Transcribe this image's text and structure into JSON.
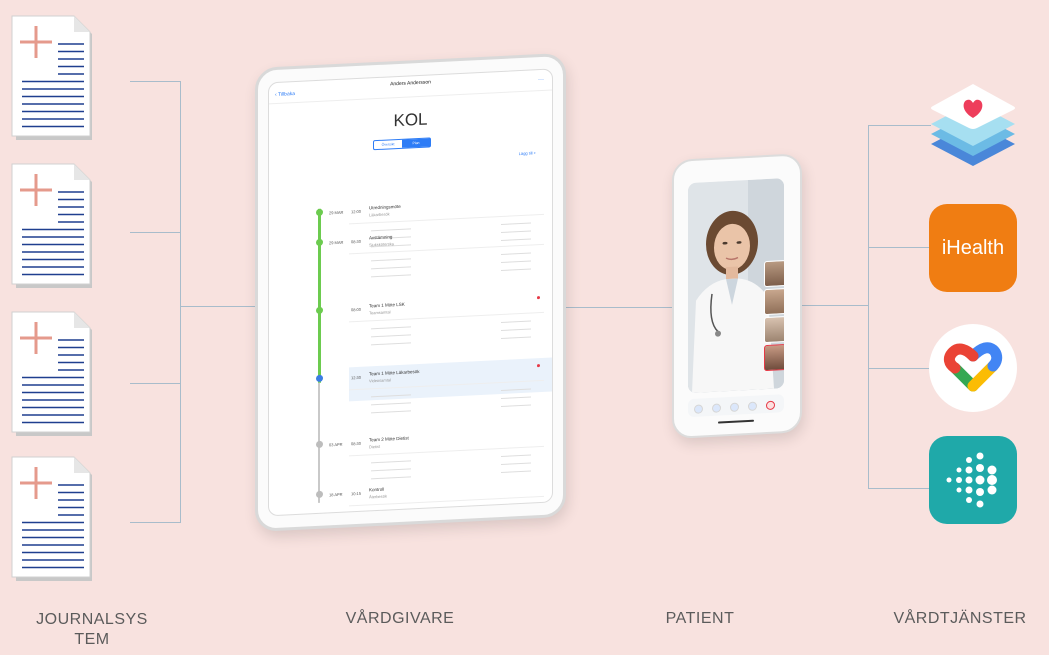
{
  "labels": {
    "journal_line1": "JOURNALSYS",
    "journal_line2": "TEM",
    "caregiver": "VÅRDGIVARE",
    "patient": "PATIENT",
    "services": "VÅRDTJÄNSTER"
  },
  "tablet": {
    "back": "Tillbaka",
    "patient_name": "Anders Andersson",
    "title": "KOL",
    "segment_left": "Översikt",
    "segment_right": "Plan",
    "add": "Lägg till",
    "rows": [
      {
        "date": "29 MAR",
        "time": "12:00",
        "title": "Utredningsmöte",
        "sub": "Läkarbesök"
      },
      {
        "date": "29 MAR",
        "time": "08:30",
        "title": "Avstämning",
        "sub": "Sjuksköterska"
      },
      {
        "date": "",
        "time": "08:00",
        "title": "Team 1 Möte LSK",
        "sub": "Teamsamtal"
      },
      {
        "date": "",
        "time": "12:30",
        "title": "Team 1 Möte Läkarbesök",
        "sub": "Videosamtal"
      },
      {
        "date": "03 APR",
        "time": "08:30",
        "title": "Team 2 Möte Dietist",
        "sub": "Dietist"
      },
      {
        "date": "18 APR",
        "time": "10:15",
        "title": "Kontroll",
        "sub": "Återbesök"
      }
    ]
  },
  "services": {
    "ihealth_label": "iHealth"
  },
  "colors": {
    "background": "#f8e2df",
    "connector": "#a8bccb",
    "ihealth": "#f07d12",
    "fitbit": "#1fa9a9",
    "timeline_active": "#6ccb4f",
    "accent": "#2d7cf6"
  },
  "icons": [
    "document-icon",
    "apple-health-icon",
    "ihealth-icon",
    "google-fit-icon",
    "fitbit-icon"
  ]
}
